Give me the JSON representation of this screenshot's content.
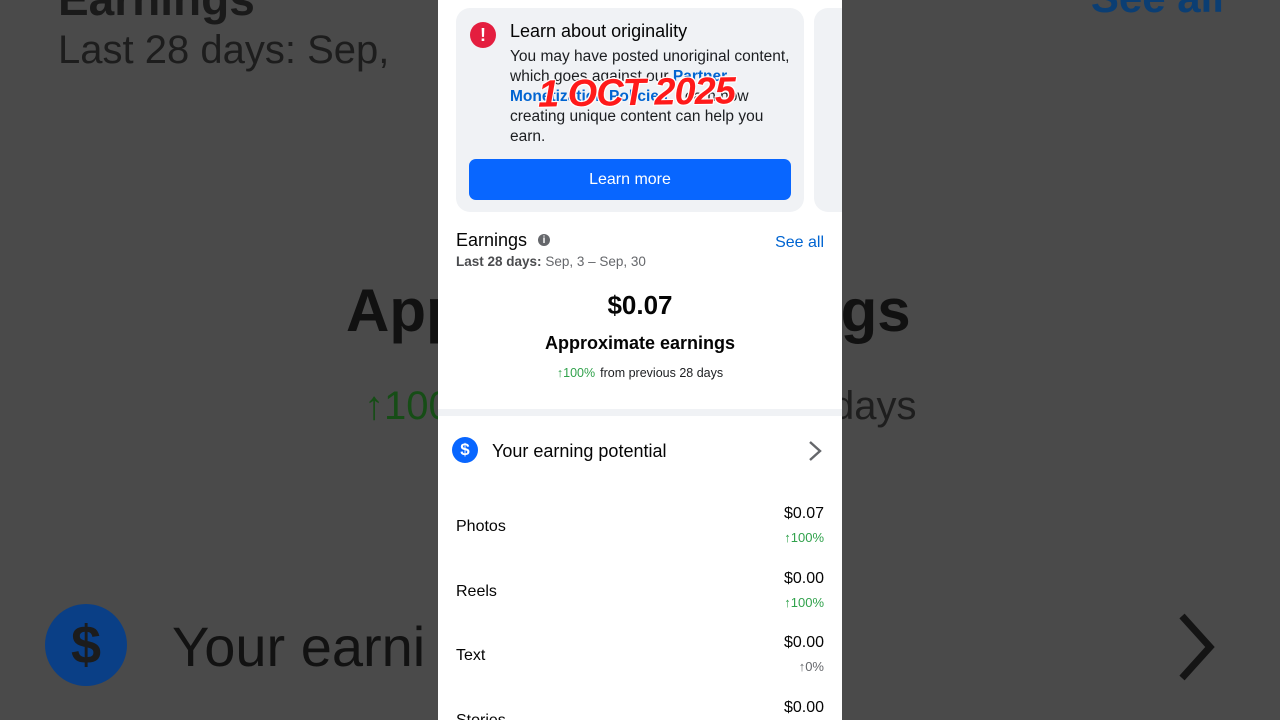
{
  "background": {
    "title": "Earnings",
    "date_label": "Last 28 days:",
    "date_range": "Sep,",
    "see_all": "See all",
    "approx_left": "App",
    "approx_right": "ngs",
    "pct": "↑100",
    "days": "days",
    "earn_text": "Your earni"
  },
  "card": {
    "title": "Learn about originality",
    "body_1": "You may have posted unoriginal content, which goes against our ",
    "link": "Partner Monetization Policies",
    "body_2": ". Learn how creating unique content can help you earn.",
    "button": "Learn more"
  },
  "watermark": "1 OCT 2025",
  "earnings": {
    "title": "Earnings",
    "see_all": "See all",
    "period_label": "Last 28 days:",
    "period": "Sep, 3 – Sep, 30",
    "amount": "$0.07",
    "amount_label": "Approximate earnings",
    "change": "↑100%",
    "change_note": "from previous 28 days"
  },
  "potential": {
    "label": "Your earning potential"
  },
  "rows": [
    {
      "label": "Photos",
      "value": "$0.07",
      "change": "↑100%",
      "trend": "up"
    },
    {
      "label": "Reels",
      "value": "$0.00",
      "change": "↑100%",
      "trend": "up"
    },
    {
      "label": "Text",
      "value": "$0.00",
      "change": "↑0%",
      "trend": "flat"
    },
    {
      "label": "Stories",
      "value": "$0.00",
      "change": "",
      "trend": "flat"
    }
  ],
  "colors": {
    "accent": "#0866ff",
    "link": "#0064d1",
    "positive": "#31a24c",
    "alert": "#e41e3f",
    "watermark": "#ff1a1a"
  },
  "icons": {
    "alert": "exclamation-icon",
    "info": "info-icon",
    "dollar": "dollar-icon",
    "chevron": "chevron-right-icon"
  }
}
